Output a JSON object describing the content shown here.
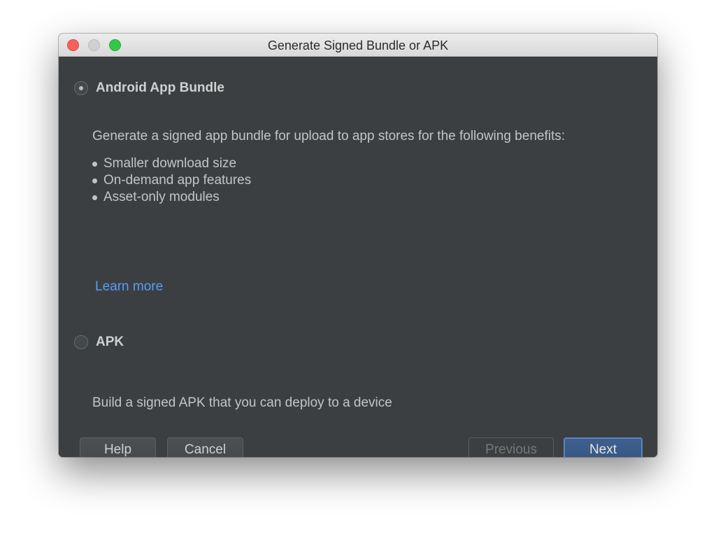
{
  "window": {
    "title": "Generate Signed Bundle or APK"
  },
  "options": {
    "bundle": {
      "label": "Android App Bundle",
      "selected": true,
      "description": "Generate a signed app bundle for upload to app stores for the following benefits:",
      "benefits": [
        "Smaller download size",
        "On-demand app features",
        "Asset-only modules"
      ],
      "link": "Learn more"
    },
    "apk": {
      "label": "APK",
      "selected": false,
      "description": "Build a signed APK that you can deploy to a device"
    }
  },
  "buttons": {
    "help": "Help",
    "cancel": "Cancel",
    "previous": "Previous",
    "next": "Next"
  },
  "colors": {
    "background": "#3c3f41",
    "link": "#589df6",
    "primary_button": "#365581",
    "close": "#fc605c",
    "zoom": "#34c84a"
  }
}
